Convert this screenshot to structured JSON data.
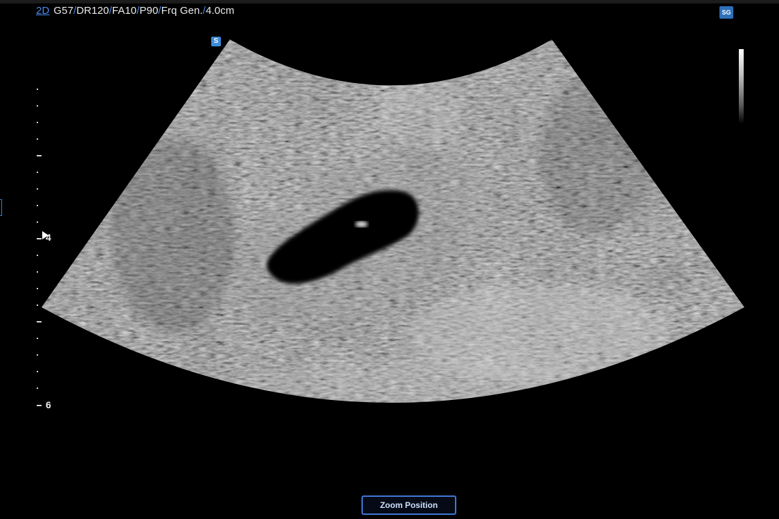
{
  "header": {
    "mode_label": "2D",
    "params": [
      "G57",
      "DR120",
      "FA10",
      "P90",
      "Frq Gen.",
      "4.0cm"
    ]
  },
  "image_area": {
    "sector_label": "S"
  },
  "logo": {
    "text": "SG",
    "icon": "scanner-logo-icon"
  },
  "depth_scale": {
    "labels": [
      "4",
      "6"
    ]
  },
  "buttons": {
    "zoom_position": "Zoom Position"
  },
  "colors": {
    "accent": "#4a8cf0",
    "button_border": "#3e78d8",
    "badge_blue": "#3c8bd6"
  }
}
